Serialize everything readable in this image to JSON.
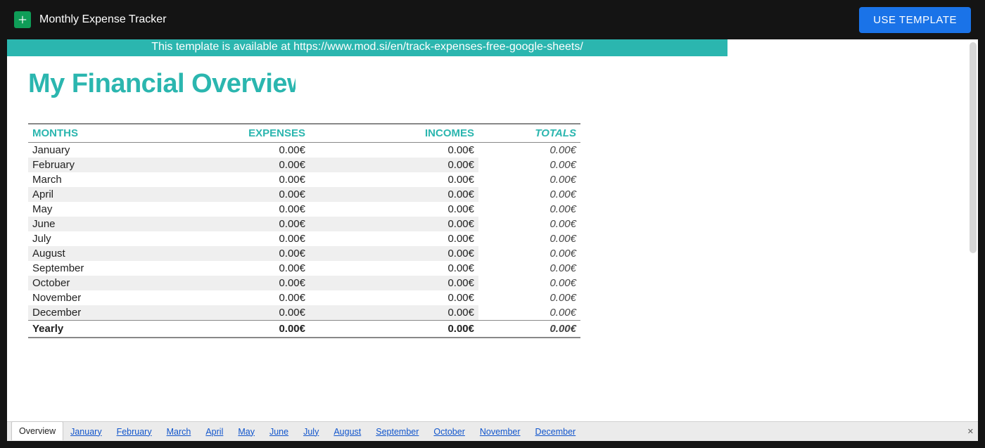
{
  "header": {
    "doc_title": "Monthly Expense Tracker",
    "use_template_label": "USE TEMPLATE"
  },
  "banner": "This template is available at https://www.mod.si/en/track-expenses-free-google-sheets/",
  "page_title": "My Financial Overview",
  "table": {
    "headers": {
      "months": "MONTHS",
      "expenses": "EXPENSES",
      "incomes": "INCOMES",
      "totals": "TOTALS"
    },
    "rows": [
      {
        "month": "January",
        "expenses": "0.00€",
        "incomes": "0.00€",
        "totals": "0.00€"
      },
      {
        "month": "February",
        "expenses": "0.00€",
        "incomes": "0.00€",
        "totals": "0.00€"
      },
      {
        "month": "March",
        "expenses": "0.00€",
        "incomes": "0.00€",
        "totals": "0.00€"
      },
      {
        "month": "April",
        "expenses": "0.00€",
        "incomes": "0.00€",
        "totals": "0.00€"
      },
      {
        "month": "May",
        "expenses": "0.00€",
        "incomes": "0.00€",
        "totals": "0.00€"
      },
      {
        "month": "June",
        "expenses": "0.00€",
        "incomes": "0.00€",
        "totals": "0.00€"
      },
      {
        "month": "July",
        "expenses": "0.00€",
        "incomes": "0.00€",
        "totals": "0.00€"
      },
      {
        "month": "August",
        "expenses": "0.00€",
        "incomes": "0.00€",
        "totals": "0.00€"
      },
      {
        "month": "September",
        "expenses": "0.00€",
        "incomes": "0.00€",
        "totals": "0.00€"
      },
      {
        "month": "October",
        "expenses": "0.00€",
        "incomes": "0.00€",
        "totals": "0.00€"
      },
      {
        "month": "November",
        "expenses": "0.00€",
        "incomes": "0.00€",
        "totals": "0.00€"
      },
      {
        "month": "December",
        "expenses": "0.00€",
        "incomes": "0.00€",
        "totals": "0.00€"
      }
    ],
    "yearly": {
      "label": "Yearly",
      "expenses": "0.00€",
      "incomes": "0.00€",
      "totals": "0.00€"
    }
  },
  "tabs": [
    "Overview",
    "January",
    "February",
    "March",
    "April",
    "May",
    "June",
    "July",
    "August",
    "September",
    "October",
    "November",
    "December"
  ],
  "active_tab_index": 0
}
